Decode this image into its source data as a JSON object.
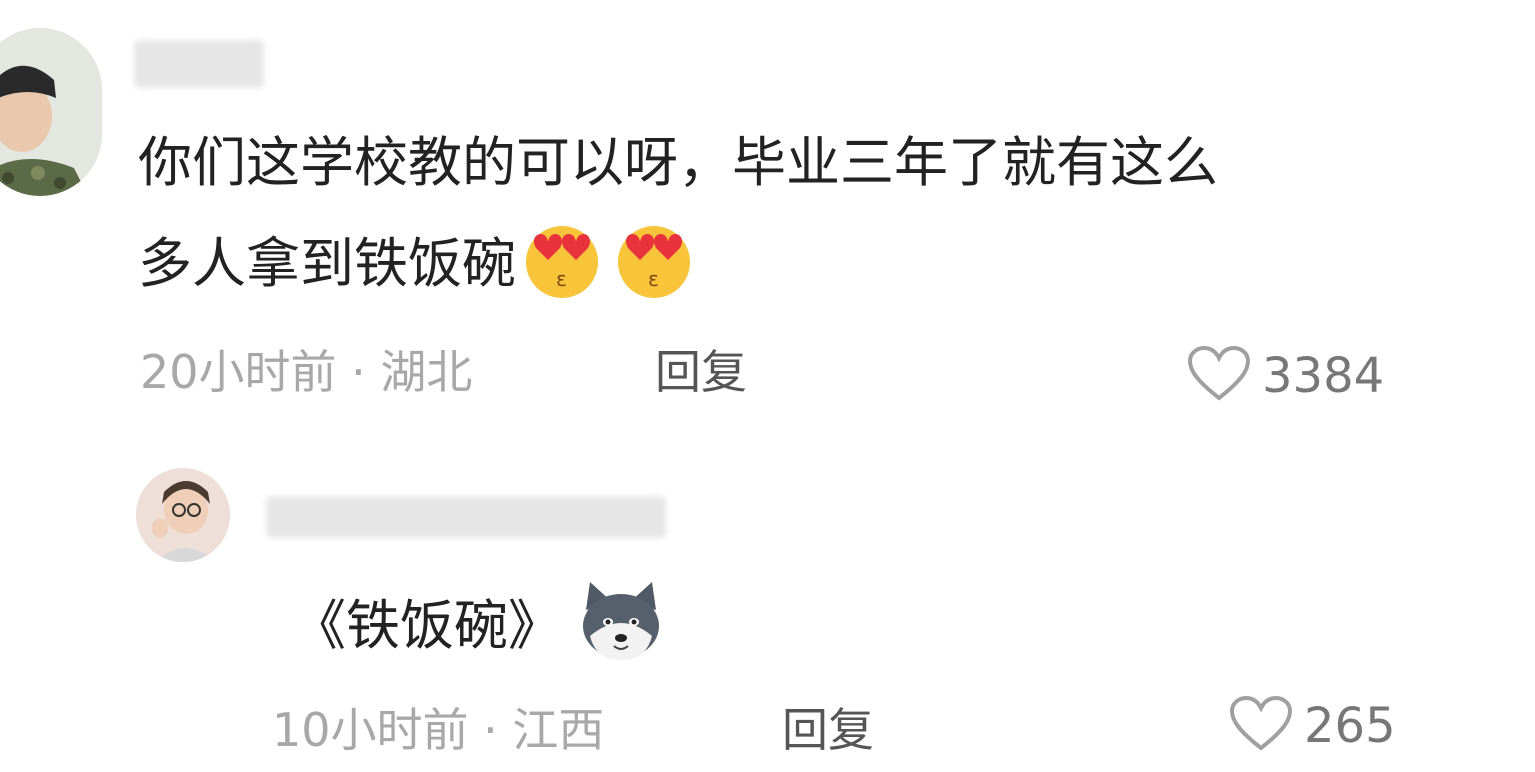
{
  "comments": [
    {
      "text_line1": "你们这学校教的可以呀，毕业三年了就有这么",
      "text_line2": "多人拿到铁饭碗",
      "emojis": [
        "heart-eyes-kiss-emoji",
        "heart-eyes-kiss-emoji"
      ],
      "time": "20小时前",
      "separator": "·",
      "location": "湖北",
      "reply_label": "回复",
      "likes": "3384"
    },
    {
      "text": "《铁饭碗》",
      "emoji": "husky-dog-emoji",
      "time": "10小时前",
      "separator": "·",
      "location": "江西",
      "reply_label": "回复",
      "likes": "265"
    }
  ],
  "colors": {
    "text": "#222222",
    "meta": "#a8a8a8",
    "reply": "#555555",
    "like": "#777777"
  }
}
